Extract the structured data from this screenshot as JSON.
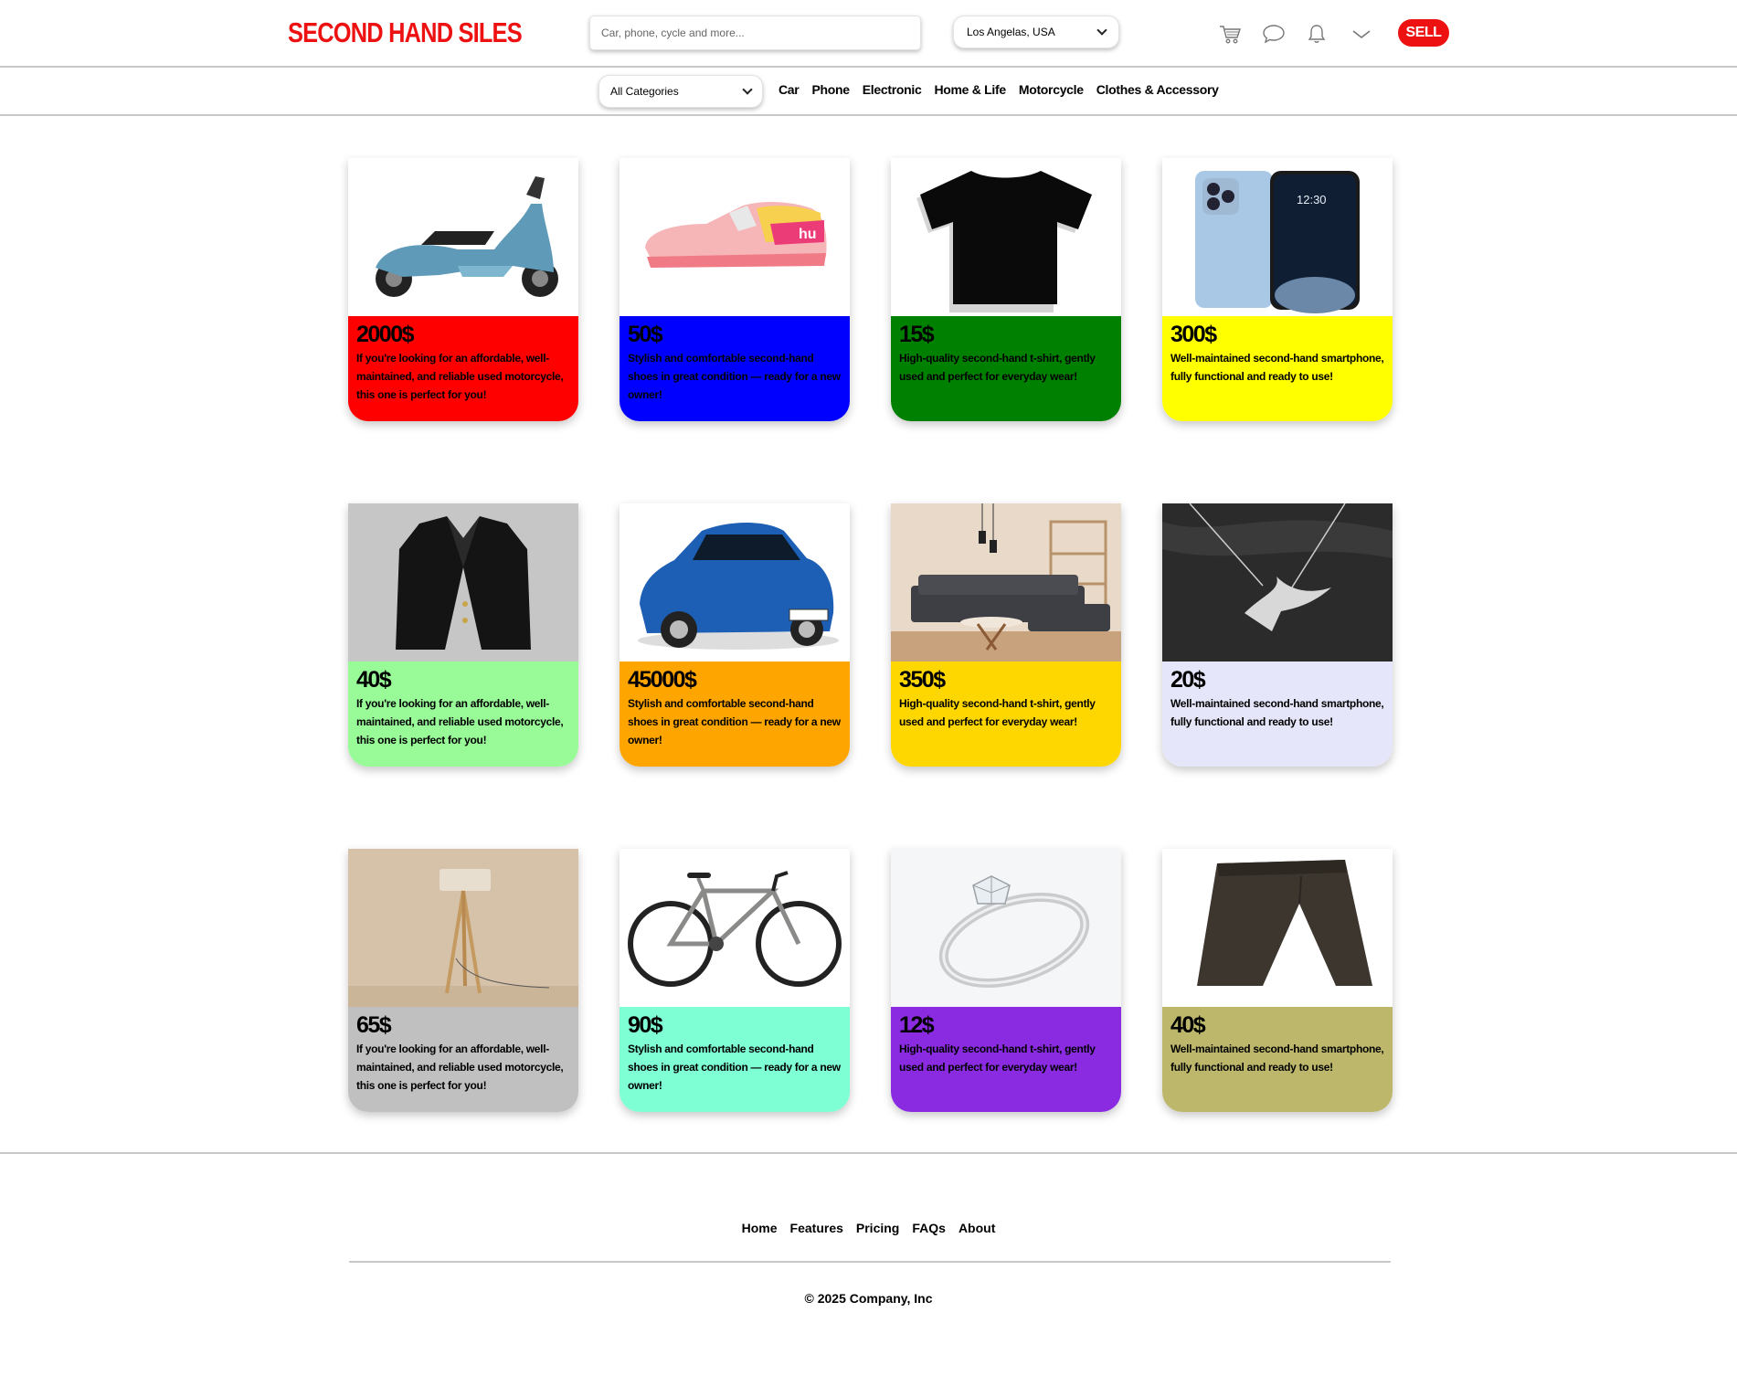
{
  "header": {
    "logo": "SECOND HAND SILES",
    "search_placeholder": "Car, phone, cycle and more...",
    "location": "Los Angelas, USA",
    "sell_label": "SELL",
    "icons": [
      "cart-icon",
      "chat-icon",
      "bell-icon",
      "chevron-down-icon"
    ]
  },
  "categories": {
    "select_label": "All Categories",
    "links": [
      "Car",
      "Phone",
      "Electronic",
      "Home & Life",
      "Motorcycle",
      "Clothes & Accessory"
    ]
  },
  "products": [
    {
      "price": "2000$",
      "desc": "If you're looking for an affordable, well-maintained, and reliable used motorcycle, this one is perfect for you!",
      "color": "#ff0000",
      "image": "scooter"
    },
    {
      "price": "50$",
      "desc": "Stylish and comfortable second-hand shoes in great condition — ready for a new owner!",
      "color": "#0000ff",
      "image": "sneaker"
    },
    {
      "price": "15$",
      "desc": "High-quality second-hand t-shirt, gently used and perfect for everyday wear!",
      "color": "#008000",
      "image": "t-shirt"
    },
    {
      "price": "300$",
      "desc": "Well-maintained second-hand smartphone, fully functional and ready to use!",
      "color": "#ffff00",
      "image": "smartphone"
    },
    {
      "price": "40$",
      "desc": "If you're looking for an affordable, well-maintained, and reliable used motorcycle, this one is perfect for you!",
      "color": "#98fb98",
      "image": "blazer"
    },
    {
      "price": "45000$",
      "desc": "Stylish and comfortable second-hand shoes in great condition — ready for a new owner!",
      "color": "#ffa500",
      "image": "car"
    },
    {
      "price": "350$",
      "desc": "High-quality second-hand t-shirt, gently used and perfect for everyday wear!",
      "color": "#ffd700",
      "image": "sofa"
    },
    {
      "price": "20$",
      "desc": "Well-maintained second-hand smartphone, fully functional and ready to use!",
      "color": "#e6e6fa",
      "image": "necklace"
    },
    {
      "price": "65$",
      "desc": "If you're looking for an affordable, well-maintained, and reliable used motorcycle, this one is perfect for you!",
      "color": "#c0c0c0",
      "image": "floor-lamp"
    },
    {
      "price": "90$",
      "desc": "Stylish and comfortable second-hand shoes in great condition — ready for a new owner!",
      "color": "#7fffd4",
      "image": "bicycle"
    },
    {
      "price": "12$",
      "desc": "High-quality second-hand t-shirt, gently used and perfect for everyday wear!",
      "color": "#8a2be2",
      "image": "ring"
    },
    {
      "price": "40$",
      "desc": "Well-maintained second-hand smartphone, fully functional and ready to use!",
      "color": "#bdb76b",
      "image": "pants"
    }
  ],
  "footer": {
    "links": [
      "Home",
      "Features",
      "Pricing",
      "FAQs",
      "About"
    ],
    "copyright": "© 2025 Company, Inc"
  }
}
